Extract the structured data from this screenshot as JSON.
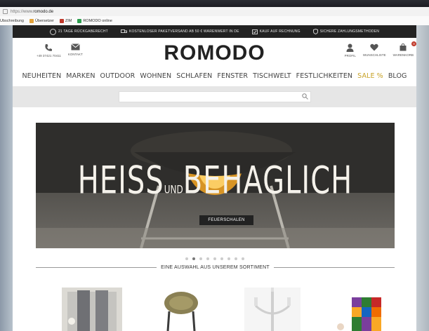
{
  "browser": {
    "url_prefix": "https://www.",
    "url_domain": "romodo.de",
    "bookmarks": [
      {
        "label": "Ubschreibung",
        "color": ""
      },
      {
        "label": "Übersetzer",
        "color": "#e2a23b"
      },
      {
        "label": "ZIM",
        "color": "#c0392b"
      },
      {
        "label": "ROMODO online",
        "color": "#2e9e4f"
      }
    ]
  },
  "topbar": {
    "usps": [
      {
        "icon": "return-icon",
        "label": "21 Tage Rückgaberecht"
      },
      {
        "icon": "truck-icon",
        "label": "Kostenloser Paketversand ab 50 € Warenwert in DE"
      },
      {
        "icon": "invoice-icon",
        "label": "Kauf auf Rechnung"
      },
      {
        "icon": "shield-icon",
        "label": "Sichere Zahlungsmethoden"
      }
    ]
  },
  "header": {
    "phone": "+49 37421 70411",
    "contact_label": "KONTAKT",
    "logo": "ROMODO",
    "profile_label": "PROFIL",
    "wishlist_label": "WUNSCHLISTE",
    "cart_label": "WARENKORB",
    "cart_count": "0"
  },
  "nav": {
    "items": [
      "NEUHEITEN",
      "MARKEN",
      "OUTDOOR",
      "WOHNEN",
      "SCHLAFEN",
      "FENSTER",
      "TISCHWELT",
      "FESTLICHKEITEN",
      "SALE %",
      "BLOG"
    ]
  },
  "search": {
    "placeholder": ""
  },
  "hero": {
    "title_left": "HEISS",
    "title_mid": "UND",
    "title_right": "BEHAGLICH",
    "button": "FEUERSCHALEN",
    "slide_count": 9,
    "active_slide": 1
  },
  "section": {
    "title": "EINE AUSWAHL AUS UNSEREM SORTIMENT"
  },
  "colors": {
    "accent_sale": "#c7a227",
    "topbar": "#222222",
    "badge": "#c0392b"
  }
}
